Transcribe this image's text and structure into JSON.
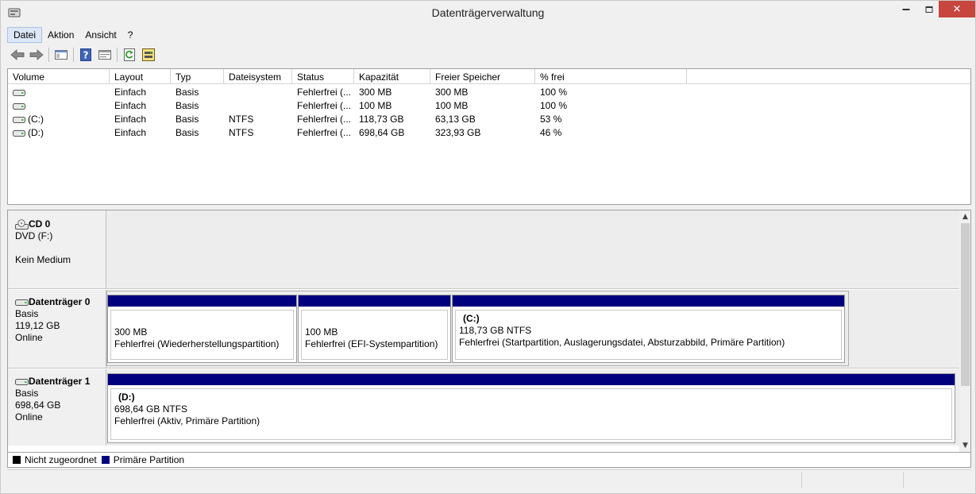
{
  "window": {
    "title": "Datenträgerverwaltung",
    "close_glyph": "✕"
  },
  "menubar": {
    "items": [
      {
        "label": "Datei"
      },
      {
        "label": "Aktion"
      },
      {
        "label": "Ansicht"
      },
      {
        "label": "?"
      }
    ]
  },
  "toolbar": {
    "buttons": [
      "back-arrow-icon",
      "forward-arrow-icon",
      "show-hide-console-tree-icon",
      "help-icon",
      "properties-icon",
      "refresh-icon",
      "rescan-disks-icon"
    ]
  },
  "volume_list": {
    "columns": [
      "Volume",
      "Layout",
      "Typ",
      "Dateisystem",
      "Status",
      "Kapazität",
      "Freier Speicher",
      "% frei"
    ],
    "rows": [
      {
        "volume": "",
        "layout": "Einfach",
        "typ": "Basis",
        "dateisystem": "",
        "status": "Fehlerfrei (...",
        "kapazitaet": "300 MB",
        "frei": "300 MB",
        "prozent": "100 %"
      },
      {
        "volume": "",
        "layout": "Einfach",
        "typ": "Basis",
        "dateisystem": "",
        "status": "Fehlerfrei (...",
        "kapazitaet": "100 MB",
        "frei": "100 MB",
        "prozent": "100 %"
      },
      {
        "volume": "(C:)",
        "layout": "Einfach",
        "typ": "Basis",
        "dateisystem": "NTFS",
        "status": "Fehlerfrei (...",
        "kapazitaet": "118,73 GB",
        "frei": "63,13 GB",
        "prozent": "53 %"
      },
      {
        "volume": "(D:)",
        "layout": "Einfach",
        "typ": "Basis",
        "dateisystem": "NTFS",
        "status": "Fehlerfrei (...",
        "kapazitaet": "698,64 GB",
        "frei": "323,93 GB",
        "prozent": "46 %"
      }
    ]
  },
  "disks": [
    {
      "name": "CD 0",
      "line1": "DVD (F:)",
      "line2": "",
      "line3": "Kein Medium"
    },
    {
      "name": "Datenträger 0",
      "line1": "Basis",
      "line2": "119,12 GB",
      "line3": "Online",
      "partitions": [
        {
          "label": "",
          "size": "300 MB",
          "status": "Fehlerfrei (Wiederherstellungspartition)"
        },
        {
          "label": "",
          "size": "100 MB",
          "status": "Fehlerfrei (EFI-Systempartition)"
        },
        {
          "label": "(C:)",
          "size": "118,73 GB NTFS",
          "status": "Fehlerfrei (Startpartition, Auslagerungsdatei, Absturzabbild, Primäre Partition)"
        }
      ]
    },
    {
      "name": "Datenträger 1",
      "line1": "Basis",
      "line2": "698,64 GB",
      "line3": "Online",
      "partitions": [
        {
          "label": "(D:)",
          "size": "698,64 GB NTFS",
          "status": "Fehlerfrei (Aktiv, Primäre Partition)"
        }
      ]
    }
  ],
  "legend": [
    {
      "label": "Nicht zugeordnet",
      "color": "#000000"
    },
    {
      "label": "Primäre Partition",
      "color": "#00007e"
    }
  ],
  "colors": {
    "primary_partition": "#00007e",
    "unallocated": "#000000",
    "close_button": "#c7463d"
  }
}
